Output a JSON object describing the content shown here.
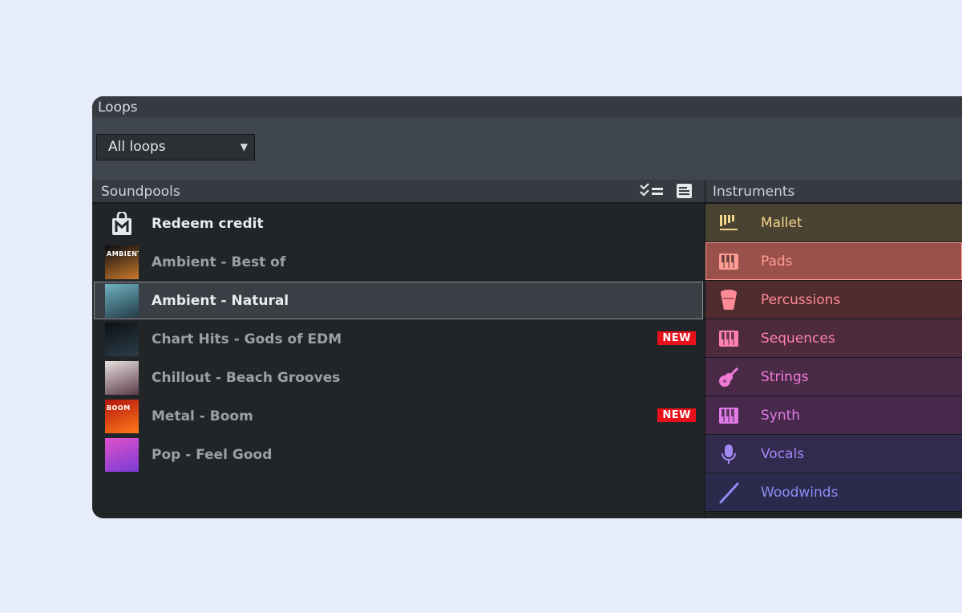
{
  "window": {
    "title": "Loops"
  },
  "toolbar": {
    "filter": {
      "value": "All loops"
    }
  },
  "soundpools": {
    "header": "Soundpools",
    "items": [
      {
        "label": "Redeem credit",
        "icon": "shopping-bag-icon",
        "bright": true
      },
      {
        "label": "Ambient - Best of",
        "thumb": [
          "#0b0d12",
          "#c9792a"
        ],
        "thumb_text": "AMBIENT"
      },
      {
        "label": "Ambient - Natural",
        "thumb": [
          "#6fb2c0",
          "#243b48"
        ],
        "selected": true,
        "bright": true
      },
      {
        "label": "Chart Hits - Gods of EDM",
        "thumb": [
          "#0c1116",
          "#2d3d48"
        ],
        "badge": "NEW"
      },
      {
        "label": "Chillout - Beach Grooves",
        "thumb": [
          "#e8e2e0",
          "#5b3b47"
        ]
      },
      {
        "label": "Metal - Boom",
        "thumb": [
          "#b4150e",
          "#ff7a1a"
        ],
        "thumb_text": "BOOM",
        "badge": "NEW"
      },
      {
        "label": "Pop - Feel Good",
        "thumb": [
          "#e051c9",
          "#7b3bd6"
        ]
      }
    ]
  },
  "instruments": {
    "header": "Instruments",
    "items": [
      {
        "label": "Mallet",
        "icon": "mallet-icon",
        "bg": "#4a4332",
        "fg": "#f0d58a"
      },
      {
        "label": "Pads",
        "icon": "keyboard-icon",
        "bg": "#9a514c",
        "fg": "#ff9d92",
        "selected": true
      },
      {
        "label": "Percussions",
        "icon": "drum-icon",
        "bg": "#512c2f",
        "fg": "#ff8a96"
      },
      {
        "label": "Sequences",
        "icon": "keyboard-icon",
        "bg": "#4d2a3c",
        "fg": "#ff82b3"
      },
      {
        "label": "Strings",
        "icon": "guitar-icon",
        "bg": "#4b2a47",
        "fg": "#f07ad6"
      },
      {
        "label": "Synth",
        "icon": "keyboard-icon",
        "bg": "#472a4b",
        "fg": "#e07ae6"
      },
      {
        "label": "Vocals",
        "icon": "microphone-icon",
        "bg": "#332b4f",
        "fg": "#a08af2"
      },
      {
        "label": "Woodwinds",
        "icon": "flute-icon",
        "bg": "#2b2a4d",
        "fg": "#8d8cf2"
      }
    ]
  }
}
